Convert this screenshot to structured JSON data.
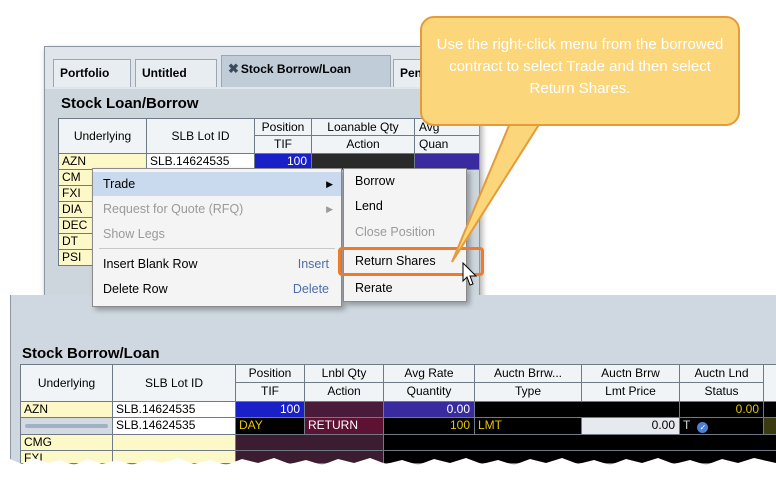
{
  "callout": {
    "text": "Use the right-click menu from the borrowed contract to select Trade and then select Return Shares."
  },
  "top_window": {
    "tabs": [
      "Portfolio",
      "Untitled",
      "Stock Borrow/Loan",
      "Pen"
    ],
    "panel_title": "Stock Loan/Borrow",
    "headers": {
      "underlying": "Underlying",
      "slb_lot_id": "SLB Lot ID",
      "position": "Position",
      "tif": "TIF",
      "loanable_qty": "Loanable Qty",
      "action": "Action",
      "avg": "Avg",
      "quan": "Quan"
    },
    "rows": [
      {
        "underlying": "AZN",
        "slb_lot_id": "SLB.14624535",
        "position": "100"
      },
      {
        "underlying": "CM"
      },
      {
        "underlying": "FXI"
      },
      {
        "underlying": "DIA"
      },
      {
        "underlying": "DEC"
      },
      {
        "underlying": "DT"
      },
      {
        "underlying": "PSI"
      }
    ]
  },
  "context_menu": {
    "items": [
      {
        "label": "Trade",
        "shortcut": "",
        "submenu": true,
        "state": "highlighted"
      },
      {
        "label": "Request for Quote (RFQ)",
        "shortcut": "",
        "submenu": true,
        "state": "disabled"
      },
      {
        "label": "Show Legs",
        "shortcut": "",
        "submenu": false,
        "state": "disabled"
      },
      {
        "label": "Insert Blank Row",
        "shortcut": "Insert",
        "submenu": false,
        "state": "normal"
      },
      {
        "label": "Delete Row",
        "shortcut": "Delete",
        "submenu": false,
        "state": "normal"
      }
    ]
  },
  "trade_submenu": {
    "items": [
      {
        "label": "Borrow",
        "state": "normal"
      },
      {
        "label": "Lend",
        "state": "normal"
      },
      {
        "label": "Close Position",
        "state": "disabled"
      },
      {
        "label": "Return Shares",
        "state": "highlighted"
      },
      {
        "label": "Rerate",
        "state": "normal"
      }
    ]
  },
  "bottom_window": {
    "panel_title": "Stock Borrow/Loan",
    "headers": {
      "underlying": "Underlying",
      "slb_lot_id": "SLB Lot ID",
      "position": "Position",
      "tif": "TIF",
      "lnbl_qty": "Lnbl Qty",
      "action": "Action",
      "avg_rate": "Avg Rate",
      "quantity": "Quantity",
      "auctn_brrw_type_top": "Auctn Brrw...",
      "type": "Type",
      "auctn_brrw_lmt_top": "Auctn Brrw",
      "lmt_price": "Lmt Price",
      "auctn_lnd": "Auctn Lnd",
      "status": "Status"
    },
    "rows": [
      {
        "underlying": "AZN",
        "slb_lot_id": "SLB.14624535",
        "position": "100",
        "quantity": "0.00",
        "status": "0.00"
      },
      {
        "underlying": "",
        "slb_lot_id": "SLB.14624535",
        "tif": "DAY",
        "action": "RETURN",
        "quantity": "100",
        "type": "LMT",
        "lmt_price": "0.00",
        "status_flag": "T"
      },
      {
        "underlying": "CMG"
      },
      {
        "underlying": "FXI"
      }
    ]
  },
  "colors": {
    "callout_fill": "#fbd67a",
    "highlight_outline": "#ee7b2c",
    "position_blue": "#1a20c8",
    "action_maroon": "#5e1233",
    "underlying_yellow": "#fdf8c8"
  }
}
